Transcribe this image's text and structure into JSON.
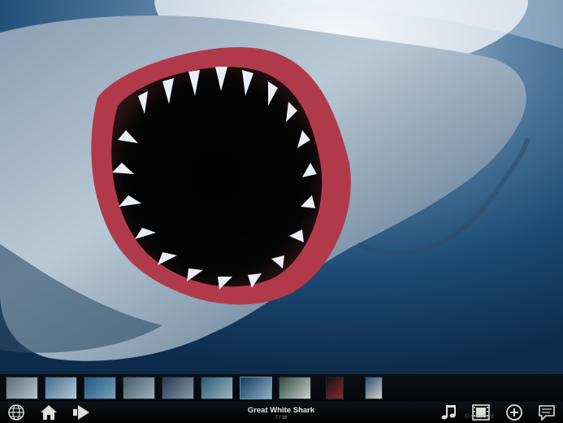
{
  "viewer": {
    "photo_subject": "Great white shark with open jaws, underwater",
    "caption_title": "Great White Shark",
    "counter": "7 / 16",
    "copyright": "© copyright ",
    "accent_color": "#6f8ba6"
  },
  "thumbnails": [
    {
      "subject": "shark",
      "tone": [
        "#5a6b78",
        "#b9c2c8"
      ]
    },
    {
      "subject": "shark",
      "tone": [
        "#3f6f93",
        "#b7c7d3"
      ]
    },
    {
      "subject": "shark",
      "tone": [
        "#1d5a80",
        "#7aa0b8"
      ]
    },
    {
      "subject": "shark",
      "tone": [
        "#415a6a",
        "#9fb0ba"
      ]
    },
    {
      "subject": "shark",
      "tone": [
        "#253a52",
        "#8899aa"
      ]
    },
    {
      "subject": "shark",
      "tone": [
        "#2b5a73",
        "#9bb6c3"
      ]
    },
    {
      "subject": "shark",
      "tone": [
        "#123a5e",
        "#8fb2c8"
      ],
      "active": true
    },
    {
      "subject": "shark",
      "tone": [
        "#2d4a3f",
        "#c8d2cd"
      ]
    },
    {
      "subject": "shark",
      "tone": [
        "#111111",
        "#8a2b2b"
      ]
    },
    {
      "subject": "shark",
      "tone": [
        "#254e76",
        "#d8d0c0"
      ]
    }
  ],
  "toolbar": {
    "left_icons": [
      "globe-icon",
      "home-icon",
      "next-arrow-icon"
    ],
    "right_icons": [
      "music-note-icon",
      "film-icon",
      "add-circle-icon",
      "comment-icon"
    ]
  }
}
